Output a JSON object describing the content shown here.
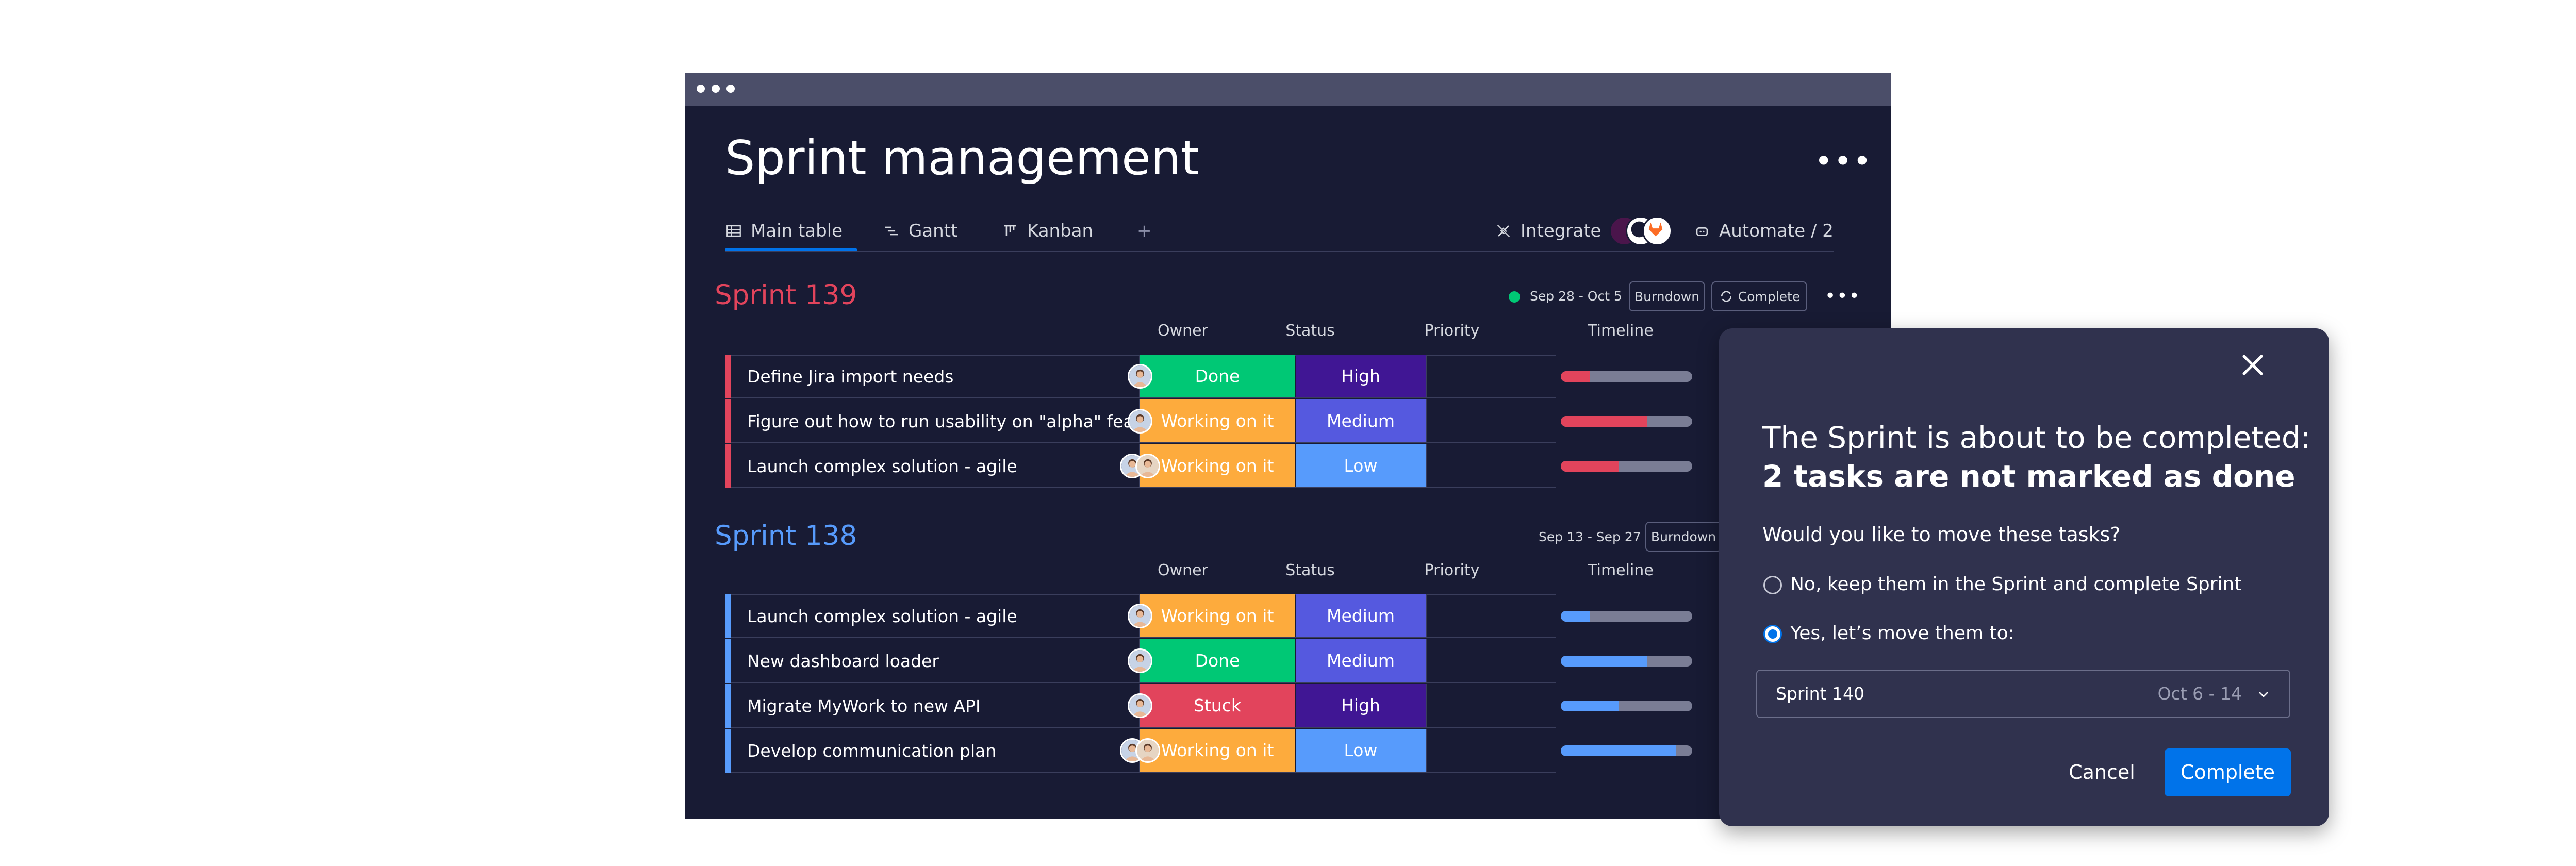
{
  "board": {
    "title": "Sprint management",
    "tabs": [
      {
        "label": "Main table",
        "icon": "table-icon",
        "active": true
      },
      {
        "label": "Gantt",
        "icon": "gantt-icon",
        "active": false
      },
      {
        "label": "Kanban",
        "icon": "kanban-icon",
        "active": false
      }
    ],
    "add_tab": "+",
    "integrate_label": "Integrate",
    "automate_label": "Automate / 2"
  },
  "columns": {
    "owner": "Owner",
    "status": "Status",
    "priority": "Priority",
    "timeline": "Timeline"
  },
  "groups": [
    {
      "title": "Sprint 139",
      "color": "#e2445c",
      "date": "Sep 28 - Oct 5",
      "burndown_label": "Burndown",
      "complete_label": "Complete",
      "rows": [
        {
          "task": "Define Jira import needs",
          "status": "Done",
          "status_color": "#00c875",
          "priority": "High",
          "priority_color": "#401694",
          "progress": 0.22,
          "owners": 1
        },
        {
          "task": "Figure out how to run usability on \"alpha\" feature",
          "status": "Working on it",
          "status_color": "#fdab3d",
          "priority": "Medium",
          "priority_color": "#5559df",
          "progress": 0.66,
          "owners": 1
        },
        {
          "task": "Launch complex solution - agile",
          "status": "Working on it",
          "status_color": "#fdab3d",
          "priority": "Low",
          "priority_color": "#579bfc",
          "progress": 0.44,
          "owners": 2
        }
      ]
    },
    {
      "title": "Sprint 138",
      "color": "#579bfc",
      "date": "Sep 13 - Sep 27",
      "burndown_label": "Burndown",
      "rows": [
        {
          "task": "Launch complex solution - agile",
          "status": "Working on it",
          "status_color": "#fdab3d",
          "priority": "Medium",
          "priority_color": "#5559df",
          "progress": 0.22,
          "owners": 1
        },
        {
          "task": "New dashboard loader",
          "status": "Done",
          "status_color": "#00c875",
          "priority": "Medium",
          "priority_color": "#5559df",
          "progress": 0.66,
          "owners": 1
        },
        {
          "task": "Migrate MyWork to new API",
          "status": "Stuck",
          "status_color": "#e2445c",
          "priority": "High",
          "priority_color": "#401694",
          "progress": 0.44,
          "owners": 1
        },
        {
          "task": "Develop communication plan",
          "status": "Working on it",
          "status_color": "#fdab3d",
          "priority": "Low",
          "priority_color": "#579bfc",
          "progress": 0.88,
          "owners": 2
        }
      ]
    }
  ],
  "modal": {
    "line1": "The Sprint is about to be completed:",
    "line2": "2 tasks are not marked as done",
    "question": "Would you like to move these tasks?",
    "option_no": "No, keep them in the Sprint and complete Sprint",
    "option_yes": "Yes, let’s move them to:",
    "selected_option": "yes",
    "select_value": "Sprint 140",
    "select_date": "Oct 6 - 14",
    "cancel_label": "Cancel",
    "complete_label": "Complete"
  }
}
